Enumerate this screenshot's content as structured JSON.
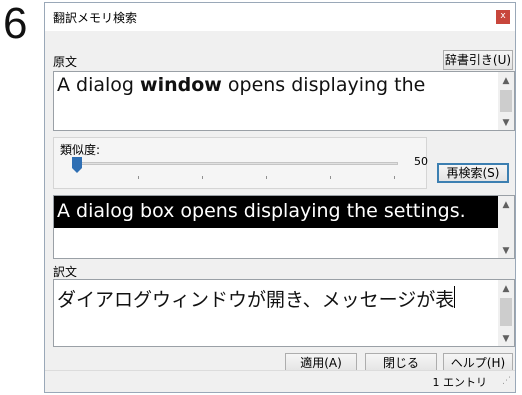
{
  "step_number": "6",
  "window": {
    "title": "翻訳メモリ検索",
    "close_glyph": "x"
  },
  "source": {
    "label": "原文",
    "dict_button": "辞書引き(U)",
    "text_before": "A dialog ",
    "text_bold": "window",
    "text_after": " opens displaying the"
  },
  "similarity": {
    "label": "類似度:",
    "value": "50",
    "level_fraction": 0.0,
    "research_button": "再検索(S)"
  },
  "match": {
    "text": "A dialog box opens displaying the settings."
  },
  "translation": {
    "label": "訳文",
    "text": "ダイアログウィンドウが開き、メッセージが表"
  },
  "buttons": {
    "apply": "適用(A)",
    "close": "閉じる",
    "help": "ヘルプ(H)"
  },
  "status": {
    "entries": "1 エントリ"
  },
  "icons": {
    "scroll_up": "scroll-up-arrow",
    "scroll_down": "scroll-down-arrow",
    "slider_thumb": "slider-thumb",
    "resize_grip": "resize-grip"
  },
  "colors": {
    "highlight_bg": "#000000",
    "close_button": "#c8463c",
    "slider_thumb": "#2f6fb3",
    "default_button_border": "#3c7fb1"
  }
}
